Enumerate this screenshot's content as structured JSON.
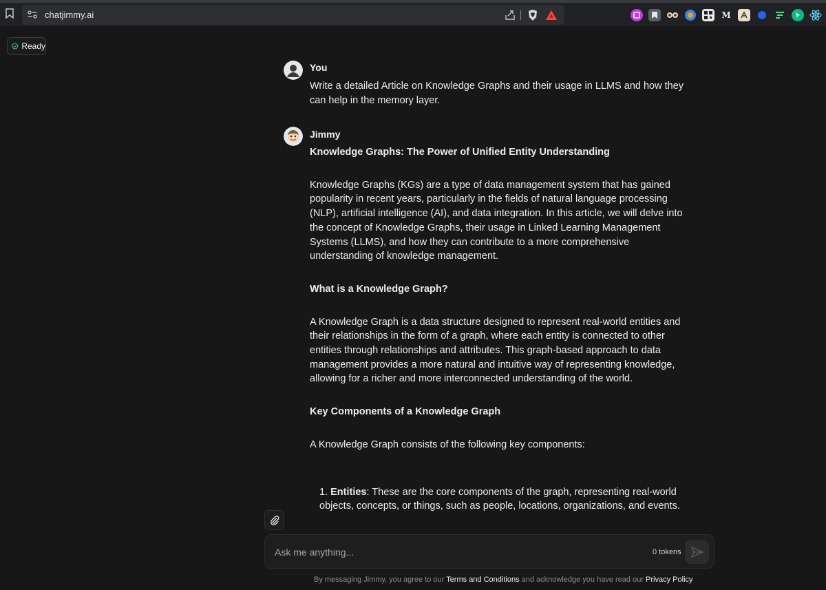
{
  "browser": {
    "url": "chatjimmy.ai",
    "extensions": [
      "purple-ext-icon",
      "bookmark-ext-icon",
      "eyes-ext-icon",
      "blue-ext-icon",
      "qr-ext-icon",
      "medium-ext-icon",
      "font-ext-icon",
      "blue-dot-ext-icon",
      "menu-ext-icon",
      "cursor-ext-icon",
      "react-ext-icon"
    ],
    "medium_label": "M"
  },
  "status": {
    "label": "Ready"
  },
  "messages": [
    {
      "author": "You",
      "text": "Write a detailed Article on Knowledge Graphs and their usage in LLMS and how they can help in the memory layer."
    },
    {
      "author": "Jimmy",
      "title": "Knowledge Graphs: The Power of Unified Entity Understanding",
      "p1": "Knowledge Graphs (KGs) are a type of data management system that has gained popularity in recent years, particularly in the fields of natural language processing (NLP), artificial intelligence (AI), and data integration. In this article, we will delve into the concept of Knowledge Graphs, their usage in Linked Learning Management Systems (LLMS), and how they can contribute to a more comprehensive understanding of knowledge management.",
      "h2": "What is a Knowledge Graph?",
      "p2": "A Knowledge Graph is a data structure designed to represent real-world entities and their relationships in the form of a graph, where each entity is connected to other entities through relationships and attributes. This graph-based approach to data management provides a more natural and intuitive way of representing knowledge, allowing for a richer and more interconnected understanding of the world.",
      "h3": "Key Components of a Knowledge Graph",
      "p3": "A Knowledge Graph consists of the following key components:",
      "list": [
        {
          "num": "1.",
          "term": "Entities",
          "text": ": These are the core components of the graph, representing real-world objects, concepts, or things, such as people, locations, organizations, and events."
        }
      ]
    }
  ],
  "input": {
    "placeholder": "Ask me anything...",
    "tokens": "0 tokens"
  },
  "footer": {
    "prefix": "By messaging Jimmy, you agree to our ",
    "terms": "Terms and Conditions",
    "middle": " and acknowledge you have read our ",
    "privacy": "Privacy Policy"
  },
  "colors": {
    "background": "#171717",
    "accent_green": "#4ade80"
  }
}
